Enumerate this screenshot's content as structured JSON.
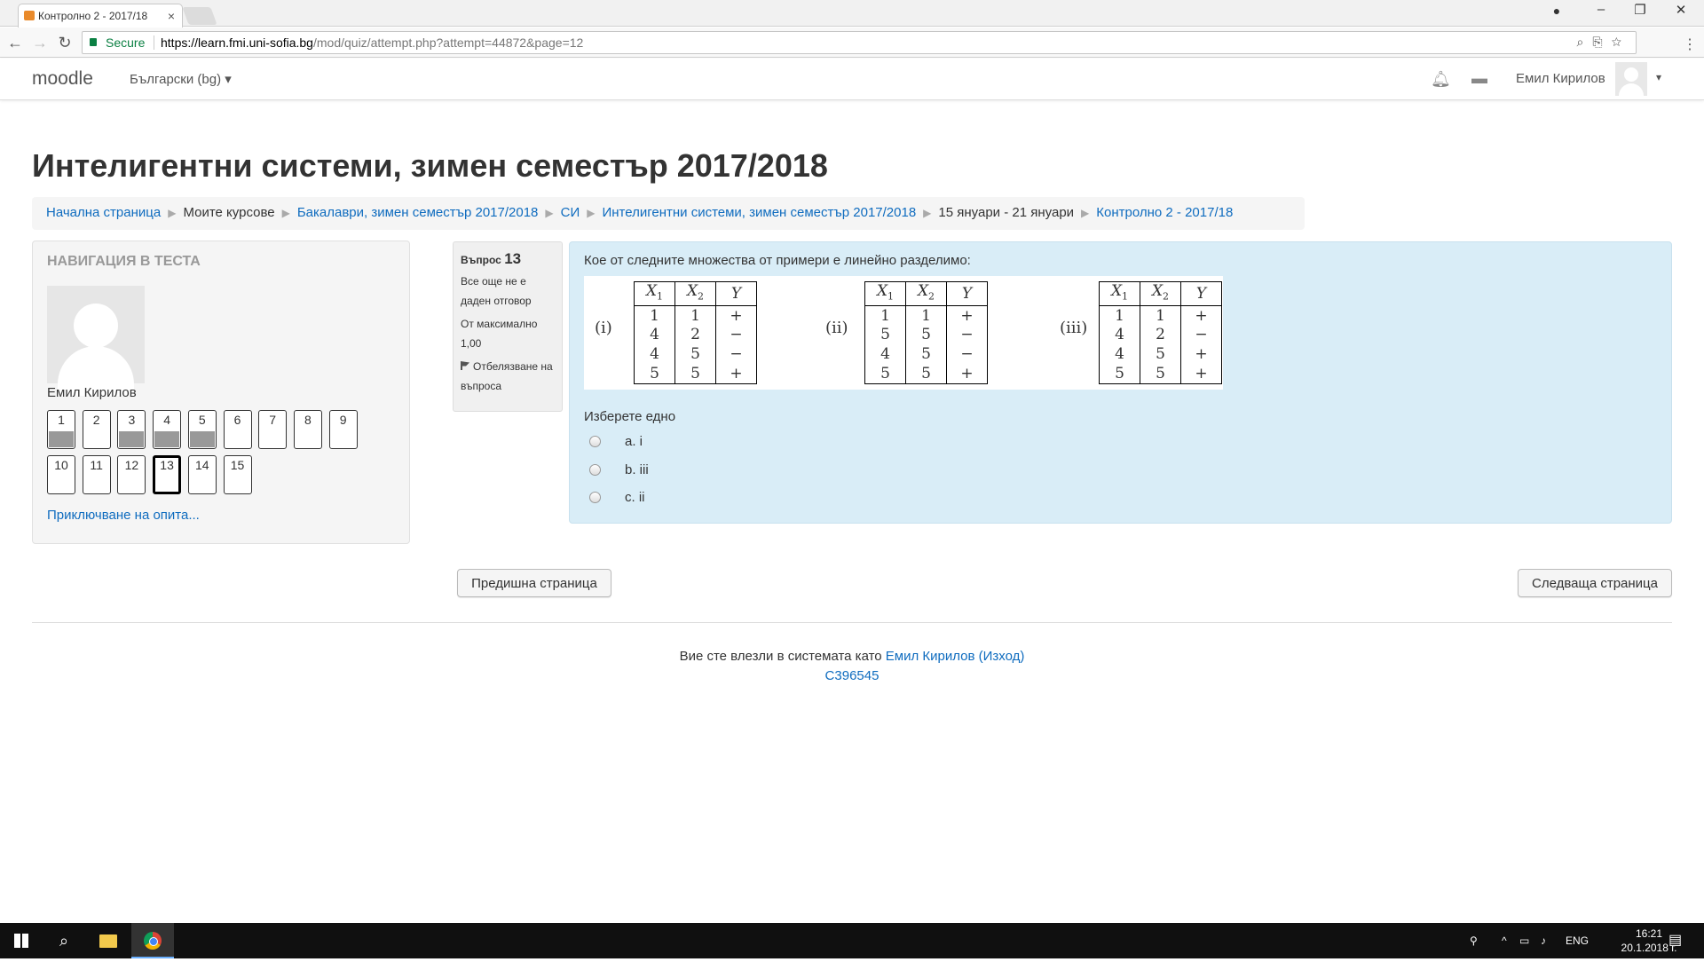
{
  "browser": {
    "tab_title": "Контролно 2 - 2017/18",
    "tab_close": "×",
    "secure_label": "Secure",
    "url_scheme_host": "https://learn.fmi.uni-sofia.bg",
    "url_path": "/mod/quiz/attempt.php?attempt=44872&page=12",
    "window_controls": [
      "‒",
      "❐",
      "✕"
    ]
  },
  "moodle": {
    "brand": "moodle",
    "language": "Български (bg) ▾",
    "user_name": "Емил Кирилов",
    "user_caret": "▾"
  },
  "page_title": "Интелигентни системи, зимен семестър 2017/2018",
  "breadcrumb": [
    {
      "label": "Начална страница",
      "link": true
    },
    {
      "label": "Моите курсове",
      "link": false
    },
    {
      "label": "Бакалаври, зимен семестър 2017/2018",
      "link": true
    },
    {
      "label": "СИ",
      "link": true
    },
    {
      "label": "Интелигентни системи, зимен семестър 2017/2018",
      "link": true
    },
    {
      "label": "15 януари - 21 януари",
      "link": false
    },
    {
      "label": "Контролно 2 - 2017/18",
      "link": true
    }
  ],
  "quiz_nav": {
    "heading": "НАВИГАЦИЯ В ТЕСТА",
    "user_name": "Емил Кирилов",
    "questions": [
      {
        "n": "1",
        "answered": true,
        "current": false
      },
      {
        "n": "2",
        "answered": false,
        "current": false
      },
      {
        "n": "3",
        "answered": true,
        "current": false
      },
      {
        "n": "4",
        "answered": true,
        "current": false
      },
      {
        "n": "5",
        "answered": true,
        "current": false
      },
      {
        "n": "6",
        "answered": false,
        "current": false
      },
      {
        "n": "7",
        "answered": false,
        "current": false
      },
      {
        "n": "8",
        "answered": false,
        "current": false
      },
      {
        "n": "9",
        "answered": false,
        "current": false
      },
      {
        "n": "10",
        "answered": false,
        "current": false
      },
      {
        "n": "11",
        "answered": false,
        "current": false
      },
      {
        "n": "12",
        "answered": false,
        "current": false
      },
      {
        "n": "13",
        "answered": false,
        "current": true
      },
      {
        "n": "14",
        "answered": false,
        "current": false
      },
      {
        "n": "15",
        "answered": false,
        "current": false
      }
    ],
    "finish_link": "Приключване на опита..."
  },
  "question_info": {
    "label": "Въпрос",
    "number": "13",
    "state": "Все още не е даден отговор",
    "max_marks": "От максимално 1,00",
    "flag_label": "Отбелязване на въпроса"
  },
  "question": {
    "text": "Кое от следните множества от примери е линейно разделимо:",
    "headers": {
      "x1": "X",
      "x1_sub": "1",
      "x2": "X",
      "x2_sub": "2",
      "y": "Y"
    },
    "tables": [
      {
        "label": "(i)",
        "rows": [
          [
            "1",
            "1",
            "+"
          ],
          [
            "4",
            "2",
            "−"
          ],
          [
            "4",
            "5",
            "−"
          ],
          [
            "5",
            "5",
            "+"
          ]
        ]
      },
      {
        "label": "(ii)",
        "rows": [
          [
            "1",
            "1",
            "+"
          ],
          [
            "5",
            "5",
            "−"
          ],
          [
            "4",
            "5",
            "−"
          ],
          [
            "5",
            "5",
            "+"
          ]
        ]
      },
      {
        "label": "(iii)",
        "rows": [
          [
            "1",
            "1",
            "+"
          ],
          [
            "4",
            "2",
            "−"
          ],
          [
            "4",
            "5",
            "+"
          ],
          [
            "5",
            "5",
            "+"
          ]
        ]
      }
    ],
    "choose_label": "Изберете едно",
    "options": [
      "a. i",
      "b. iii",
      "c. ii"
    ]
  },
  "buttons": {
    "prev": "Предишна страница",
    "next": "Следваща страница"
  },
  "footer": {
    "logged_in_as": "Вие сте влезли в системата като",
    "user_link": "Емил Кирилов",
    "logout": "(Изход)",
    "id": "C396545"
  },
  "taskbar": {
    "language": "ENG",
    "time": "16:21",
    "date": "20.1.2018 г."
  }
}
